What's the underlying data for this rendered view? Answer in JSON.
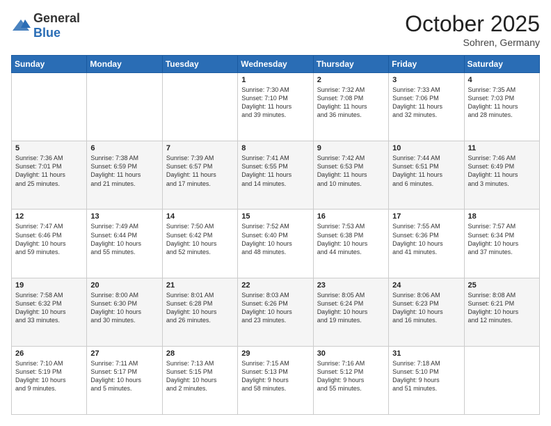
{
  "header": {
    "logo_general": "General",
    "logo_blue": "Blue",
    "month_title": "October 2025",
    "location": "Sohren, Germany"
  },
  "days_of_week": [
    "Sunday",
    "Monday",
    "Tuesday",
    "Wednesday",
    "Thursday",
    "Friday",
    "Saturday"
  ],
  "weeks": [
    [
      {
        "day": "",
        "info": ""
      },
      {
        "day": "",
        "info": ""
      },
      {
        "day": "",
        "info": ""
      },
      {
        "day": "1",
        "info": "Sunrise: 7:30 AM\nSunset: 7:10 PM\nDaylight: 11 hours\nand 39 minutes."
      },
      {
        "day": "2",
        "info": "Sunrise: 7:32 AM\nSunset: 7:08 PM\nDaylight: 11 hours\nand 36 minutes."
      },
      {
        "day": "3",
        "info": "Sunrise: 7:33 AM\nSunset: 7:06 PM\nDaylight: 11 hours\nand 32 minutes."
      },
      {
        "day": "4",
        "info": "Sunrise: 7:35 AM\nSunset: 7:03 PM\nDaylight: 11 hours\nand 28 minutes."
      }
    ],
    [
      {
        "day": "5",
        "info": "Sunrise: 7:36 AM\nSunset: 7:01 PM\nDaylight: 11 hours\nand 25 minutes."
      },
      {
        "day": "6",
        "info": "Sunrise: 7:38 AM\nSunset: 6:59 PM\nDaylight: 11 hours\nand 21 minutes."
      },
      {
        "day": "7",
        "info": "Sunrise: 7:39 AM\nSunset: 6:57 PM\nDaylight: 11 hours\nand 17 minutes."
      },
      {
        "day": "8",
        "info": "Sunrise: 7:41 AM\nSunset: 6:55 PM\nDaylight: 11 hours\nand 14 minutes."
      },
      {
        "day": "9",
        "info": "Sunrise: 7:42 AM\nSunset: 6:53 PM\nDaylight: 11 hours\nand 10 minutes."
      },
      {
        "day": "10",
        "info": "Sunrise: 7:44 AM\nSunset: 6:51 PM\nDaylight: 11 hours\nand 6 minutes."
      },
      {
        "day": "11",
        "info": "Sunrise: 7:46 AM\nSunset: 6:49 PM\nDaylight: 11 hours\nand 3 minutes."
      }
    ],
    [
      {
        "day": "12",
        "info": "Sunrise: 7:47 AM\nSunset: 6:46 PM\nDaylight: 10 hours\nand 59 minutes."
      },
      {
        "day": "13",
        "info": "Sunrise: 7:49 AM\nSunset: 6:44 PM\nDaylight: 10 hours\nand 55 minutes."
      },
      {
        "day": "14",
        "info": "Sunrise: 7:50 AM\nSunset: 6:42 PM\nDaylight: 10 hours\nand 52 minutes."
      },
      {
        "day": "15",
        "info": "Sunrise: 7:52 AM\nSunset: 6:40 PM\nDaylight: 10 hours\nand 48 minutes."
      },
      {
        "day": "16",
        "info": "Sunrise: 7:53 AM\nSunset: 6:38 PM\nDaylight: 10 hours\nand 44 minutes."
      },
      {
        "day": "17",
        "info": "Sunrise: 7:55 AM\nSunset: 6:36 PM\nDaylight: 10 hours\nand 41 minutes."
      },
      {
        "day": "18",
        "info": "Sunrise: 7:57 AM\nSunset: 6:34 PM\nDaylight: 10 hours\nand 37 minutes."
      }
    ],
    [
      {
        "day": "19",
        "info": "Sunrise: 7:58 AM\nSunset: 6:32 PM\nDaylight: 10 hours\nand 33 minutes."
      },
      {
        "day": "20",
        "info": "Sunrise: 8:00 AM\nSunset: 6:30 PM\nDaylight: 10 hours\nand 30 minutes."
      },
      {
        "day": "21",
        "info": "Sunrise: 8:01 AM\nSunset: 6:28 PM\nDaylight: 10 hours\nand 26 minutes."
      },
      {
        "day": "22",
        "info": "Sunrise: 8:03 AM\nSunset: 6:26 PM\nDaylight: 10 hours\nand 23 minutes."
      },
      {
        "day": "23",
        "info": "Sunrise: 8:05 AM\nSunset: 6:24 PM\nDaylight: 10 hours\nand 19 minutes."
      },
      {
        "day": "24",
        "info": "Sunrise: 8:06 AM\nSunset: 6:23 PM\nDaylight: 10 hours\nand 16 minutes."
      },
      {
        "day": "25",
        "info": "Sunrise: 8:08 AM\nSunset: 6:21 PM\nDaylight: 10 hours\nand 12 minutes."
      }
    ],
    [
      {
        "day": "26",
        "info": "Sunrise: 7:10 AM\nSunset: 5:19 PM\nDaylight: 10 hours\nand 9 minutes."
      },
      {
        "day": "27",
        "info": "Sunrise: 7:11 AM\nSunset: 5:17 PM\nDaylight: 10 hours\nand 5 minutes."
      },
      {
        "day": "28",
        "info": "Sunrise: 7:13 AM\nSunset: 5:15 PM\nDaylight: 10 hours\nand 2 minutes."
      },
      {
        "day": "29",
        "info": "Sunrise: 7:15 AM\nSunset: 5:13 PM\nDaylight: 9 hours\nand 58 minutes."
      },
      {
        "day": "30",
        "info": "Sunrise: 7:16 AM\nSunset: 5:12 PM\nDaylight: 9 hours\nand 55 minutes."
      },
      {
        "day": "31",
        "info": "Sunrise: 7:18 AM\nSunset: 5:10 PM\nDaylight: 9 hours\nand 51 minutes."
      },
      {
        "day": "",
        "info": ""
      }
    ]
  ]
}
